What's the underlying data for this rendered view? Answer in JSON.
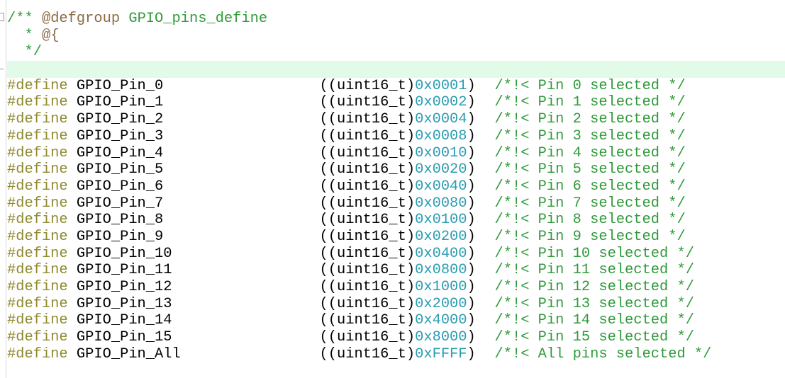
{
  "header_comment": {
    "open": "/** ",
    "tag": "@defgroup",
    "group_name": " GPIO_pins_define",
    "line2_star": "  * ",
    "line2_tag": "@{",
    "line3": "  */"
  },
  "colors": {
    "comment": "#2f9a3a",
    "preprocessor": "#8f8a2e",
    "number": "#2a9cb0",
    "doc_tag": "#8a6a44",
    "current_line": "#e2fae8"
  },
  "defines": [
    {
      "keyword": "#define",
      "name": "GPIO_Pin_0",
      "cast": "((uint16_t)",
      "value": "0x0001",
      "close": ")",
      "comment": "/*!< Pin 0 selected */"
    },
    {
      "keyword": "#define",
      "name": "GPIO_Pin_1",
      "cast": "((uint16_t)",
      "value": "0x0002",
      "close": ")",
      "comment": "/*!< Pin 1 selected */"
    },
    {
      "keyword": "#define",
      "name": "GPIO_Pin_2",
      "cast": "((uint16_t)",
      "value": "0x0004",
      "close": ")",
      "comment": "/*!< Pin 2 selected */"
    },
    {
      "keyword": "#define",
      "name": "GPIO_Pin_3",
      "cast": "((uint16_t)",
      "value": "0x0008",
      "close": ")",
      "comment": "/*!< Pin 3 selected */"
    },
    {
      "keyword": "#define",
      "name": "GPIO_Pin_4",
      "cast": "((uint16_t)",
      "value": "0x0010",
      "close": ")",
      "comment": "/*!< Pin 4 selected */"
    },
    {
      "keyword": "#define",
      "name": "GPIO_Pin_5",
      "cast": "((uint16_t)",
      "value": "0x0020",
      "close": ")",
      "comment": "/*!< Pin 5 selected */"
    },
    {
      "keyword": "#define",
      "name": "GPIO_Pin_6",
      "cast": "((uint16_t)",
      "value": "0x0040",
      "close": ")",
      "comment": "/*!< Pin 6 selected */"
    },
    {
      "keyword": "#define",
      "name": "GPIO_Pin_7",
      "cast": "((uint16_t)",
      "value": "0x0080",
      "close": ")",
      "comment": "/*!< Pin 7 selected */"
    },
    {
      "keyword": "#define",
      "name": "GPIO_Pin_8",
      "cast": "((uint16_t)",
      "value": "0x0100",
      "close": ")",
      "comment": "/*!< Pin 8 selected */"
    },
    {
      "keyword": "#define",
      "name": "GPIO_Pin_9",
      "cast": "((uint16_t)",
      "value": "0x0200",
      "close": ")",
      "comment": "/*!< Pin 9 selected */"
    },
    {
      "keyword": "#define",
      "name": "GPIO_Pin_10",
      "cast": "((uint16_t)",
      "value": "0x0400",
      "close": ")",
      "comment": "/*!< Pin 10 selected */"
    },
    {
      "keyword": "#define",
      "name": "GPIO_Pin_11",
      "cast": "((uint16_t)",
      "value": "0x0800",
      "close": ")",
      "comment": "/*!< Pin 11 selected */"
    },
    {
      "keyword": "#define",
      "name": "GPIO_Pin_12",
      "cast": "((uint16_t)",
      "value": "0x1000",
      "close": ")",
      "comment": "/*!< Pin 12 selected */"
    },
    {
      "keyword": "#define",
      "name": "GPIO_Pin_13",
      "cast": "((uint16_t)",
      "value": "0x2000",
      "close": ")",
      "comment": "/*!< Pin 13 selected */"
    },
    {
      "keyword": "#define",
      "name": "GPIO_Pin_14",
      "cast": "((uint16_t)",
      "value": "0x4000",
      "close": ")",
      "comment": "/*!< Pin 14 selected */"
    },
    {
      "keyword": "#define",
      "name": "GPIO_Pin_15",
      "cast": "((uint16_t)",
      "value": "0x8000",
      "close": ")",
      "comment": "/*!< Pin 15 selected */"
    },
    {
      "keyword": "#define",
      "name": "GPIO_Pin_All",
      "cast": "((uint16_t)",
      "value": "0xFFFF",
      "close": ")",
      "comment": "/*!< All pins selected */"
    }
  ]
}
